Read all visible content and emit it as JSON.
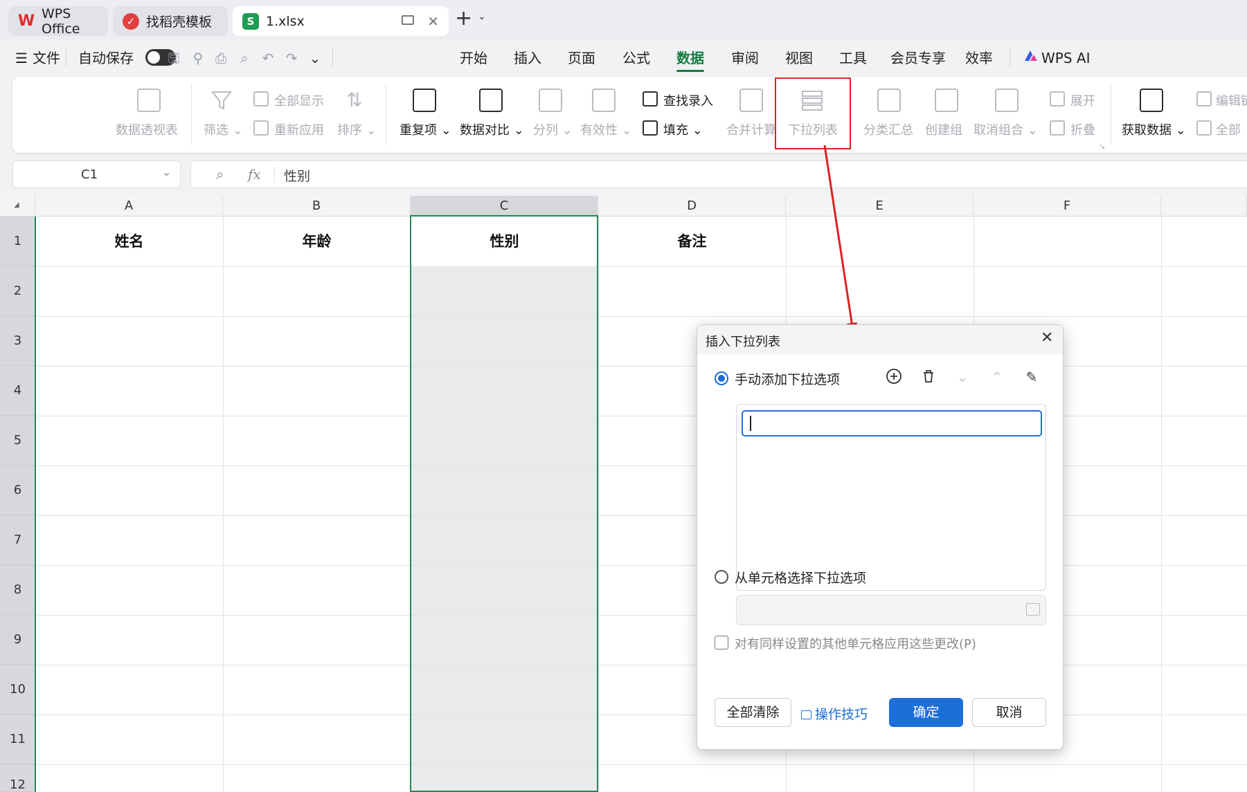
{
  "tabs": [
    {
      "label": "WPS Office"
    },
    {
      "label": "找稻壳模板"
    },
    {
      "label": "1.xlsx",
      "icon_letter": "S"
    }
  ],
  "menu": {
    "file": "文件",
    "autosave": "自动保存",
    "items": [
      "开始",
      "插入",
      "页面",
      "公式",
      "数据",
      "审阅",
      "视图",
      "工具",
      "会员专享",
      "效率"
    ],
    "active": "数据",
    "wps_ai": "WPS AI"
  },
  "ribbon": {
    "pivot": "数据透视表",
    "filter": "筛选",
    "show_all": "全部显示",
    "reapply": "重新应用",
    "sort": "排序",
    "duplicates": "重复项",
    "compare": "数据对比",
    "split": "分列",
    "validity": "有效性",
    "lookup_entry": "查找录入",
    "fill": "填充",
    "consolidate": "合并计算",
    "dropdown_list": "下拉列表",
    "subtotal": "分类汇总",
    "group": "创建组",
    "ungroup": "取消组合",
    "expand": "展开",
    "collapse": "折叠",
    "get_data": "获取数据",
    "edit": "编辑链",
    "all": "全部"
  },
  "formula_bar": {
    "cell_ref": "C1",
    "fx": "fx",
    "value": "性别"
  },
  "grid": {
    "columns": [
      "A",
      "B",
      "C",
      "D",
      "E",
      "F"
    ],
    "rows": [
      "1",
      "2",
      "3",
      "4",
      "5",
      "6",
      "7",
      "8",
      "9",
      "10",
      "11",
      "12"
    ],
    "header_row": [
      "姓名",
      "年龄",
      "性别",
      "备注",
      "",
      ""
    ],
    "selected_column": "C"
  },
  "dialog": {
    "title": "插入下拉列表",
    "option_manual": "手动添加下拉选项",
    "option_from_cells": "从单元格选择下拉选项",
    "apply_checkbox": "对有同样设置的其他单元格应用这些更改(P)",
    "clear_all": "全部清除",
    "tips": "操作技巧",
    "ok": "确定",
    "cancel": "取消",
    "input_value": ""
  },
  "colors": {
    "accent_green": "#107c41",
    "selection_green": "#1f8a58",
    "primary_blue": "#1d6fd8",
    "highlight_red": "#e02020"
  }
}
